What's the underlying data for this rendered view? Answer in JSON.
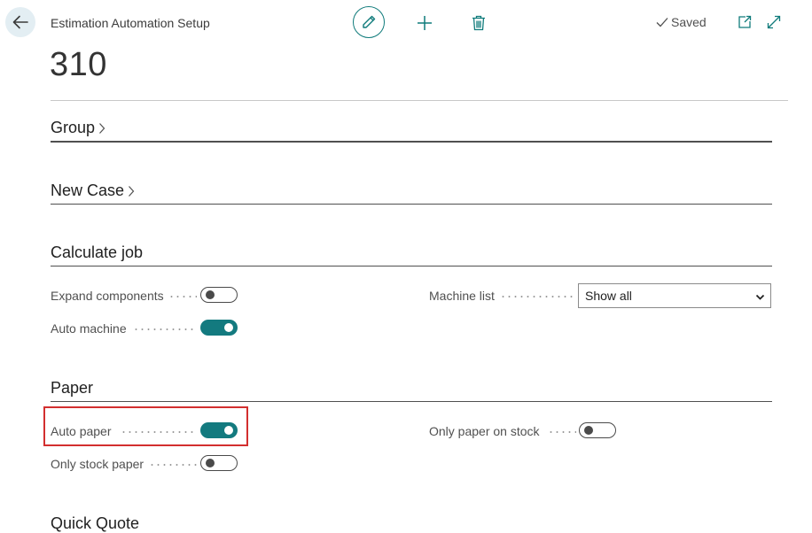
{
  "header": {
    "caption": "Estimation Automation Setup",
    "status": "Saved",
    "record_title": "310"
  },
  "icons": {
    "back": "back-arrow-icon",
    "edit": "pencil-icon",
    "new": "plus-icon",
    "delete": "trash-icon",
    "saved": "checkmark-icon",
    "open_new_window": "open-in-new-window-icon",
    "expand": "expand-icon"
  },
  "sections": {
    "group": {
      "title": "Group"
    },
    "new_case": {
      "title": "New Case"
    },
    "calculate_job": {
      "title": "Calculate job",
      "expand_components": {
        "label": "Expand components",
        "value": false
      },
      "auto_machine": {
        "label": "Auto machine",
        "value": true
      },
      "machine_list": {
        "label": "Machine list",
        "value": "Show all"
      }
    },
    "paper": {
      "title": "Paper",
      "auto_paper": {
        "label": "Auto paper",
        "value": true
      },
      "only_stock_paper": {
        "label": "Only stock paper",
        "value": false
      },
      "only_paper_on_stock": {
        "label": "Only paper on stock",
        "value": false
      }
    },
    "quick_quote": {
      "title": "Quick Quote"
    }
  },
  "colors": {
    "accent": "#137a7f",
    "highlight": "#d32f2f"
  }
}
